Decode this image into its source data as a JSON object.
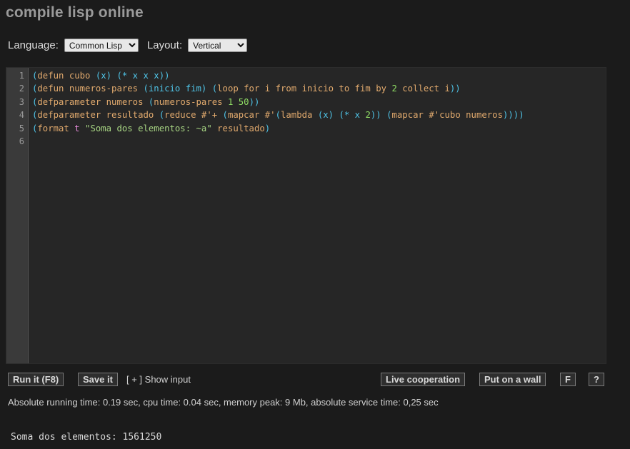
{
  "header": {
    "title": "compile lisp online"
  },
  "settings": {
    "language_label": "Language:",
    "language_value": "Common Lisp",
    "layout_label": "Layout:",
    "layout_value": "Vertical"
  },
  "editor": {
    "line_numbers": [
      "1",
      "2",
      "3",
      "4",
      "5",
      "6"
    ],
    "lines": [
      [
        [
          "p",
          "("
        ],
        [
          "k",
          "defun cubo "
        ],
        [
          "p",
          "(x)"
        ],
        [
          "k",
          " "
        ],
        [
          "p",
          "(* x x x))"
        ]
      ],
      [
        [
          "p",
          "("
        ],
        [
          "k",
          "defun numeros-pares "
        ],
        [
          "p",
          "(inicio fim)"
        ],
        [
          "k",
          " "
        ],
        [
          "p",
          "("
        ],
        [
          "k",
          "loop for i from inicio to fim by "
        ],
        [
          "n",
          "2"
        ],
        [
          "k",
          " collect i"
        ],
        [
          "p",
          "))"
        ]
      ],
      [
        [
          "p",
          "("
        ],
        [
          "k",
          "defparameter numeros "
        ],
        [
          "p",
          "("
        ],
        [
          "k",
          "numeros-pares "
        ],
        [
          "n",
          "1"
        ],
        [
          "k",
          " "
        ],
        [
          "n",
          "50"
        ],
        [
          "p",
          "))"
        ]
      ],
      [
        [
          "p",
          "("
        ],
        [
          "k",
          "defparameter resultado "
        ],
        [
          "p",
          "("
        ],
        [
          "k",
          "reduce #'+ "
        ],
        [
          "p",
          "("
        ],
        [
          "k",
          "mapcar #'"
        ],
        [
          "p",
          "("
        ],
        [
          "k",
          "lambda "
        ],
        [
          "p",
          "(x)"
        ],
        [
          "k",
          " "
        ],
        [
          "p",
          "(* x "
        ],
        [
          "n",
          "2"
        ],
        [
          "p",
          "))"
        ],
        [
          "k",
          " "
        ],
        [
          "p",
          "("
        ],
        [
          "k",
          "mapcar #'cubo numeros"
        ],
        [
          "p",
          "))))"
        ]
      ],
      [
        [
          "p",
          "("
        ],
        [
          "k",
          "format "
        ],
        [
          "c",
          "t"
        ],
        [
          "k",
          " "
        ],
        [
          "s",
          "\"Soma dos elementos: ~a\""
        ],
        [
          "k",
          " resultado"
        ],
        [
          "p",
          ")"
        ]
      ],
      []
    ]
  },
  "toolbar": {
    "run_label": "Run it (F8)",
    "save_label": "Save it",
    "show_input_label": "[ + ] Show input",
    "live_label": "Live cooperation",
    "wall_label": "Put on a wall",
    "f_label": "F",
    "help_label": "?"
  },
  "status": {
    "text": "Absolute running time: 0.19 sec, cpu time: 0.04 sec, memory peak: 9 Mb, absolute service time: 0,25 sec"
  },
  "output": {
    "text": "Soma dos elementos: 1561250"
  }
}
